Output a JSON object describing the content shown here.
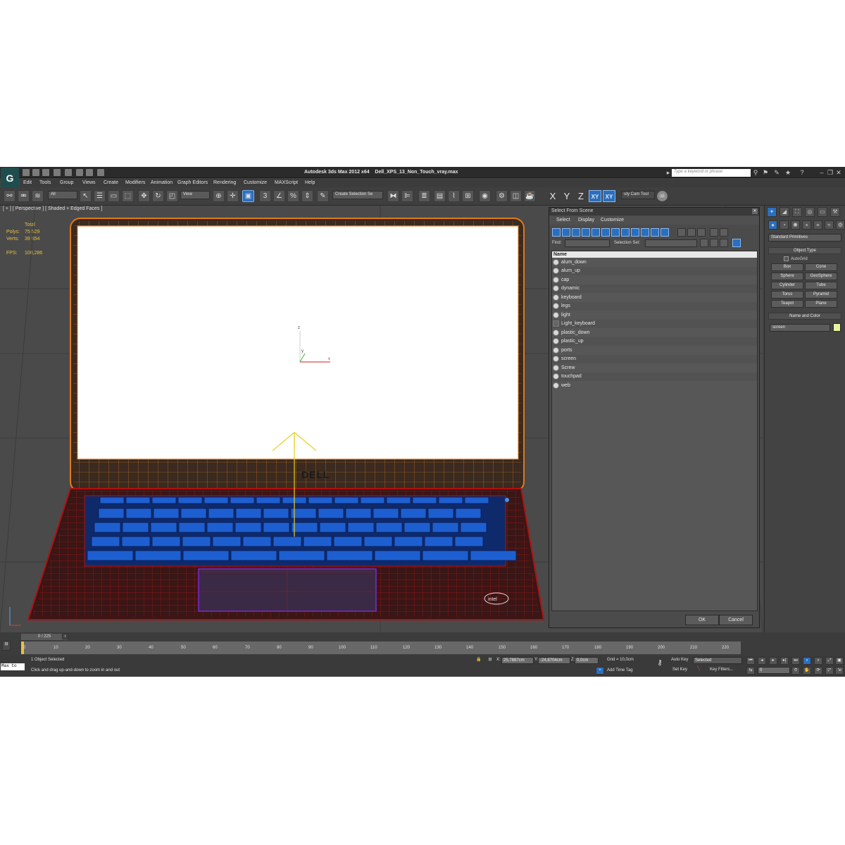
{
  "title_bar": {
    "app_title": "Autodesk 3ds Max  2012 x64",
    "file_name": "Dell_XPS_13_Non_Touch_vray.max",
    "search_placeholder": "Type a keyword or phrase",
    "logo_letter": "G"
  },
  "menu": [
    "Edit",
    "Tools",
    "Group",
    "Views",
    "Create",
    "Modifiers",
    "Animation",
    "Graph Editors",
    "Rendering",
    "Customize",
    "MAXScript",
    "Help"
  ],
  "toolbar": {
    "filter_dropdown": "All",
    "coord_dropdown": "View",
    "selection_set_dropdown": "Create Selection Se",
    "axis_x": "X",
    "axis_y": "Y",
    "axis_z": "Z",
    "axis_xy": "XY",
    "axis_xy2": "XY",
    "cam_tool_label": "uty Cam Tool"
  },
  "viewport": {
    "label": "[ + ] [ Perspective ] [ Shaded + Edged Faces ]",
    "stats": {
      "header": "Total",
      "polys_label": "Polys:",
      "polys_value": "75 529",
      "verts_label": "Verts:",
      "verts_value": "39 554",
      "fps_label": "FPS:",
      "fps_value": "108,286"
    },
    "axis_z": "z",
    "axis_y": "y",
    "axis_x": "x",
    "brand_logo": "DELL",
    "sticker_logo": "intel"
  },
  "select_dialog": {
    "title": "Select From Scene",
    "menu": [
      "Select",
      "Display",
      "Customize"
    ],
    "find_label": "Find:",
    "selection_set_label": "Selection Set:",
    "column_name": "Name",
    "items": [
      "alum_down",
      "alum_up",
      "cap",
      "dynamic",
      "keyboard",
      "legs",
      "light",
      "Light_keyboard",
      "plastic_down",
      "plastic_up",
      "ports",
      "screen",
      "Screw",
      "touchpad",
      "web"
    ],
    "ok_label": "OK",
    "cancel_label": "Cancel"
  },
  "command_panel": {
    "category_dropdown": "Standard Primitives",
    "object_type_header": "Object Type",
    "autogrid_label": "AutoGrid",
    "buttons": [
      "Box",
      "Cone",
      "Sphere",
      "GeoSphere",
      "Cylinder",
      "Tube",
      "Torus",
      "Pyramid",
      "Teapot",
      "Plane"
    ],
    "name_color_header": "Name and Color",
    "name_value": "screen",
    "color": "#e8f5a0"
  },
  "timeline": {
    "slider_text": "0 / 225",
    "ticks": [
      "0",
      "10",
      "20",
      "30",
      "40",
      "50",
      "60",
      "70",
      "80",
      "90",
      "100",
      "110",
      "120",
      "130",
      "140",
      "150",
      "160",
      "170",
      "180",
      "190",
      "200",
      "210",
      "220"
    ]
  },
  "status_bar": {
    "script_listener": "Max to",
    "selection_status": "1 Object Selected",
    "prompt": "Click and drag up-and-down to zoom in and out",
    "x_label": "X:",
    "x_value": "25,7887cm",
    "y_label": "Y:",
    "y_value": "-24,8704cm",
    "z_label": "Z:",
    "z_value": "0,0cm",
    "grid_label": "Grid = 10,0cm",
    "add_time_tag": "Add Time Tag",
    "auto_key": "Auto Key",
    "auto_key_dropdown": "Selected",
    "set_key": "Set Key",
    "key_filters": "Key Filters...",
    "frame_value": "0"
  },
  "colors": {
    "accent": "#2a6fbf",
    "stats_text": "#e8c340",
    "wire_lid": "#e07a1a",
    "wire_base": "#b01010",
    "key_blue": "#1d5fd0"
  }
}
